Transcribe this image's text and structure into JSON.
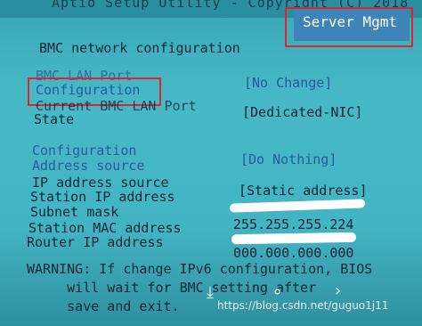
{
  "header": {
    "title": "Aptio Setup Utility - Copyright (C) 2018",
    "active_tab": "Server Mgmt"
  },
  "section": {
    "title": "BMC network configuration"
  },
  "bmc_lan_port": {
    "label_line1": "BMC LAN Port",
    "label_line2": "Configuration",
    "value": "[No Change]"
  },
  "current_port": {
    "label_line1": "Current BMC LAN Port",
    "label_line2": "State",
    "value": "[Dedicated-NIC]"
  },
  "config_address_source": {
    "label_line1": "Configuration",
    "label_line2": "Address source",
    "value": "[Do Nothing]"
  },
  "ip_address_source": {
    "label": "IP address source",
    "value": "[Static address]"
  },
  "station_ip": {
    "label": "Station IP address"
  },
  "subnet_mask": {
    "label": "Subnet mask",
    "value": "255.255.255.224"
  },
  "station_mac": {
    "label": "Station MAC address"
  },
  "router_ip": {
    "label": "Router IP address",
    "value": "000.000.000.000"
  },
  "warning": {
    "line1": "WARNING: If change IPv6 configuration, BIOS",
    "line2": "     will wait for BMC setting after",
    "line3": "     save and exit."
  },
  "watermark": {
    "text": "https://blog.csdn.net/guguo1j11"
  },
  "colors": {
    "highlight_box": "#e0242c",
    "tab_background": "#3f84b6",
    "screen_background": "#43b4c2"
  },
  "icons": {
    "download": "download-icon",
    "search": "search-icon",
    "next": "chevron-right-icon"
  }
}
